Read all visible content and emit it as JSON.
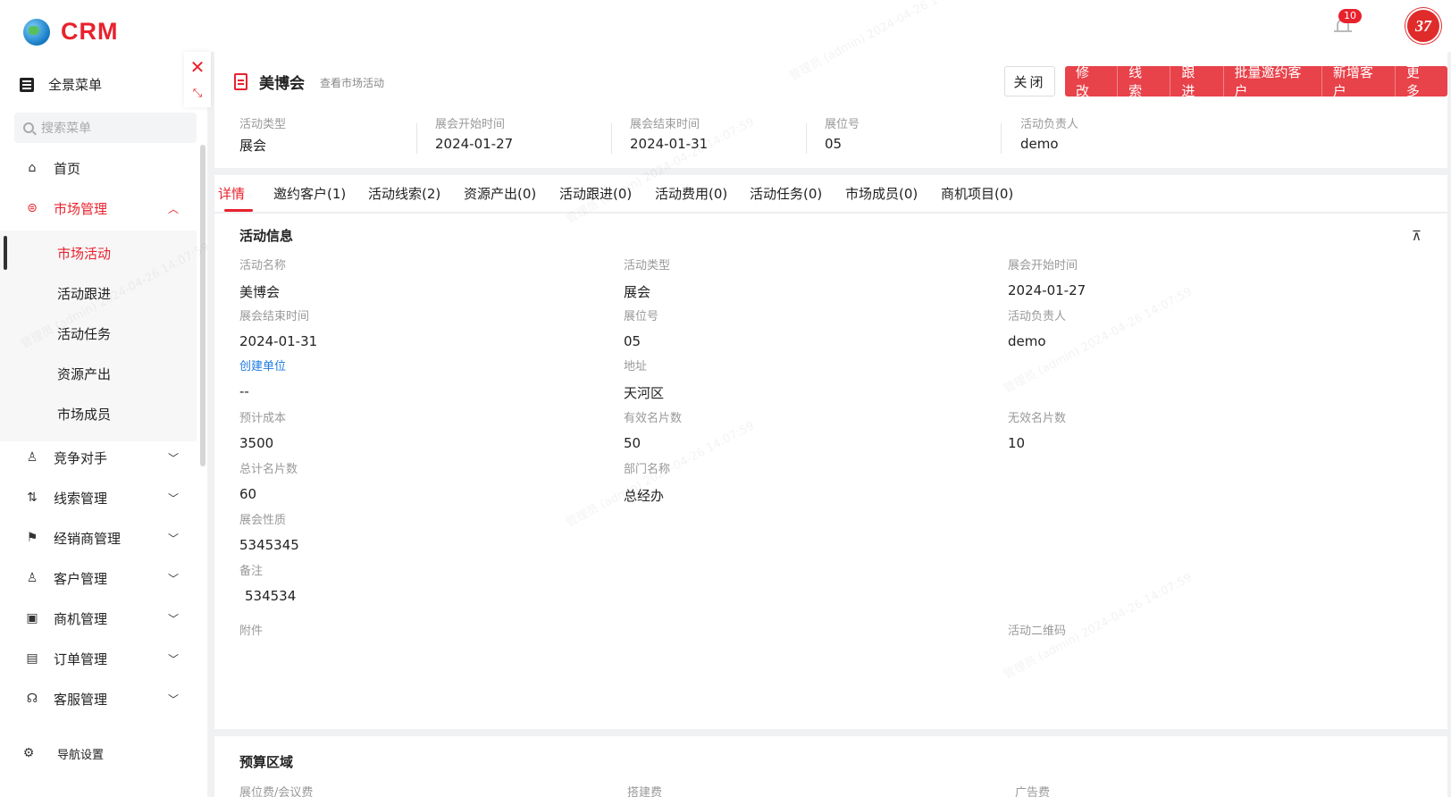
{
  "app": {
    "logo_text": "CRM",
    "notification_count": "10",
    "brand_avatar_text": "37"
  },
  "sidebar": {
    "full_menu_label": "全景菜单",
    "search_placeholder": "搜索菜单",
    "home": "首页",
    "market": "市场管理",
    "market_sub": [
      "市场活动",
      "活动跟进",
      "活动任务",
      "资源产出",
      "市场成员"
    ],
    "items": [
      {
        "label": "竞争对手",
        "icon": "competitor-icon"
      },
      {
        "label": "线索管理",
        "icon": "lead-icon"
      },
      {
        "label": "经销商管理",
        "icon": "dealer-icon"
      },
      {
        "label": "客户管理",
        "icon": "customer-icon"
      },
      {
        "label": "商机管理",
        "icon": "opportunity-icon"
      },
      {
        "label": "订单管理",
        "icon": "order-icon"
      },
      {
        "label": "客服管理",
        "icon": "service-icon"
      }
    ],
    "nav_settings": "导航设置"
  },
  "header": {
    "title": "美博会",
    "subtitle": "查看市场活动",
    "close_btn": "关闭",
    "actions": [
      "修改",
      "线索",
      "跟进",
      "批量邀约客户",
      "新增客户",
      "更多"
    ]
  },
  "summary": [
    {
      "label": "活动类型",
      "value": "展会"
    },
    {
      "label": "展会开始时间",
      "value": "2024-01-27"
    },
    {
      "label": "展会结束时间",
      "value": "2024-01-31"
    },
    {
      "label": "展位号",
      "value": "05"
    },
    {
      "label": "活动负责人",
      "value": "demo"
    }
  ],
  "tabs": [
    "详情",
    "邀约客户(1)",
    "活动线索(2)",
    "资源产出(0)",
    "活动跟进(0)",
    "活动费用(0)",
    "活动任务(0)",
    "市场成员(0)",
    "商机项目(0)"
  ],
  "detail": {
    "section_title": "活动信息",
    "fields": {
      "name": {
        "label": "活动名称",
        "value": "美博会"
      },
      "type": {
        "label": "活动类型",
        "value": "展会"
      },
      "start": {
        "label": "展会开始时间",
        "value": "2024-01-27"
      },
      "end": {
        "label": "展会结束时间",
        "value": "2024-01-31"
      },
      "booth": {
        "label": "展位号",
        "value": "05"
      },
      "owner": {
        "label": "活动负责人",
        "value": "demo"
      },
      "creator": {
        "label": "创建单位",
        "value": "--"
      },
      "address": {
        "label": "地址",
        "value": "天河区"
      },
      "budget": {
        "label": "预计成本",
        "value": "3500"
      },
      "valid_cards": {
        "label": "有效名片数",
        "value": "50"
      },
      "invalid_cards": {
        "label": "无效名片数",
        "value": "10"
      },
      "total_cards": {
        "label": "总计名片数",
        "value": "60"
      },
      "dept": {
        "label": "部门名称",
        "value": "总经办"
      },
      "nature": {
        "label": "展会性质",
        "value": "5345345"
      },
      "remark": {
        "label": "备注",
        "value": "534534"
      },
      "attachment": {
        "label": "附件"
      },
      "qrcode": {
        "label": "活动二维码"
      }
    }
  },
  "budget": {
    "section_title": "预算区域",
    "fields": [
      "展位费/会议费",
      "搭建费",
      "广告费"
    ]
  },
  "watermark": "管理员 (admin) 2024-04-26 14:07:59"
}
